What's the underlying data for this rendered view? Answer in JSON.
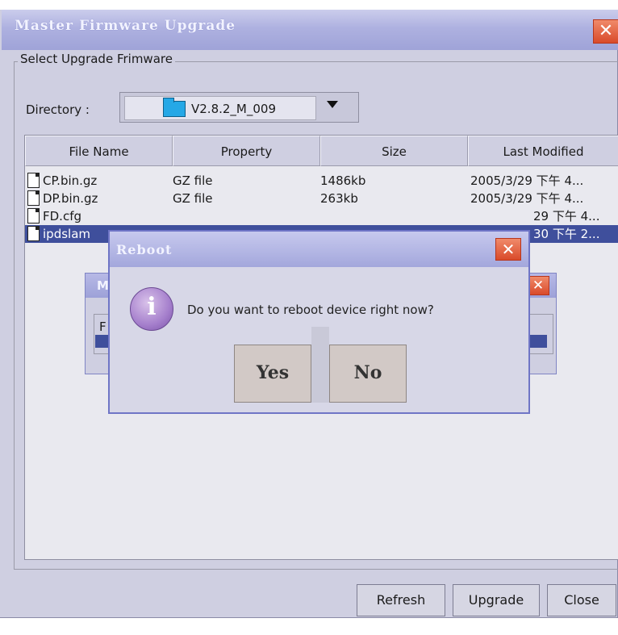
{
  "window": {
    "title": "Master Firmware Upgrade",
    "close_glyph": "✕"
  },
  "group": {
    "label": "Select Upgrade Frimware"
  },
  "directory": {
    "label": "Directory :",
    "value": "V2.8.2_M_009"
  },
  "table": {
    "columns": [
      "File Name",
      "Property",
      "Size",
      "Last Modified"
    ],
    "rows": [
      {
        "name": "CP.bin.gz",
        "property": "GZ file",
        "size": "1486kb",
        "modified": "2005/3/29 下午 4..."
      },
      {
        "name": "DP.bin.gz",
        "property": "GZ file",
        "size": "263kb",
        "modified": "2005/3/29 下午 4..."
      },
      {
        "name": "FD.cfg",
        "property": "",
        "size": "",
        "modified": "29 下午 4..."
      },
      {
        "name": "ipdslam",
        "property": "",
        "size": "",
        "modified": "30 下午 2..."
      }
    ],
    "selected_row": 3
  },
  "buttons": {
    "refresh": "Refresh",
    "upgrade": "Upgrade",
    "close": "Close"
  },
  "bg_dialog": {
    "title": "M",
    "field_label": "F"
  },
  "reboot_dialog": {
    "title": "Reboot",
    "message": "Do you want to reboot device right now?",
    "yes": "Yes",
    "no": "No",
    "close_glyph": "✕",
    "icon": "info-icon"
  },
  "colors": {
    "titlebar": "#a9ace0",
    "selection": "#3f4f9c",
    "close_button": "#d94a2a"
  }
}
